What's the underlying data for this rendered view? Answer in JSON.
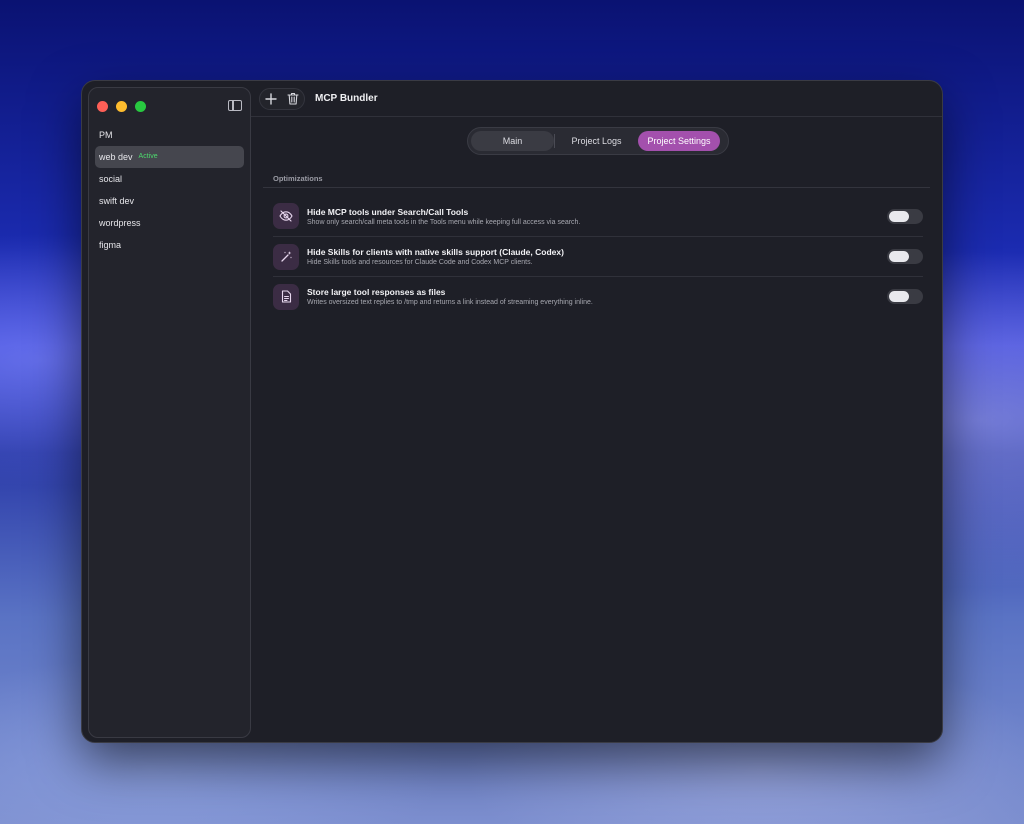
{
  "toolbar": {
    "title": "MCP Bundler",
    "add_icon": "plus-icon",
    "delete_icon": "trash-icon"
  },
  "sidebar": {
    "toggle_icon": "sidebar-toggle-icon",
    "items": [
      {
        "label": "PM"
      },
      {
        "label": "web dev",
        "badge": "Active"
      },
      {
        "label": "social"
      },
      {
        "label": "swift dev"
      },
      {
        "label": "wordpress"
      },
      {
        "label": "figma"
      }
    ]
  },
  "tabs": [
    {
      "label": "Main"
    },
    {
      "label": "Project Logs"
    },
    {
      "label": "Project Settings"
    }
  ],
  "section": {
    "title": "Optimizations"
  },
  "settings": [
    {
      "icon": "eye-slash-icon",
      "title": "Hide MCP tools under Search/Call Tools",
      "description": "Show only search/call meta tools in the Tools menu while keeping full access via search.",
      "enabled": false
    },
    {
      "icon": "magic-wand-icon",
      "title": "Hide Skills for clients with native skills support (Claude, Codex)",
      "description": "Hide Skills tools and resources for Claude Code and Codex MCP clients.",
      "enabled": false
    },
    {
      "icon": "document-icon",
      "title": "Store large tool responses as files",
      "description": "Writes oversized text replies to /tmp and returns a link instead of streaming everything inline.",
      "enabled": false
    }
  ],
  "colors": {
    "accent": "#a350ad",
    "active_badge": "#4ddb6e",
    "window_bg": "#1e1f27"
  }
}
